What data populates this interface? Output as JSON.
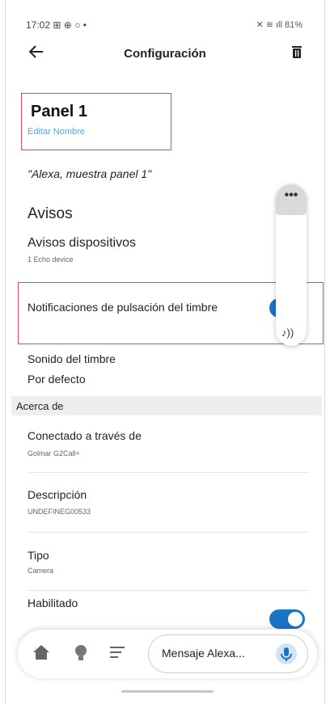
{
  "status_bar": {
    "time": "17:02",
    "icons": "⊞ ⊕ ○ •",
    "right": "✕ ≋ ıll 81%"
  },
  "header": {
    "title": "Configuración",
    "back_icon": "arrow-left-icon",
    "trash_icon": "trash-icon"
  },
  "device": {
    "name": "Panel 1",
    "edit_label": "Editar Nombre",
    "alexa_phrase": "\"Alexa, muestra panel 1\""
  },
  "avisos": {
    "heading": "Avisos",
    "dispositivos_title": "Avisos dispositivos",
    "dispositivos_sub": "1 Echo device",
    "notif_label": "Notificaciones de pulsación del timbre",
    "notif_enabled": true
  },
  "timbre": {
    "title": "Sonido del timbre",
    "value": "Por defecto"
  },
  "about": {
    "heading": "Acerca de",
    "items": [
      {
        "title": "Conectado a través de",
        "value": "Golmar G2Call+"
      },
      {
        "title": "Descripción",
        "value": "UNDEFINEG00533"
      },
      {
        "title": "Tipo",
        "value": "Camera"
      }
    ],
    "enabled_title": "Habilitado",
    "enabled": true
  },
  "floating": {
    "dots": "•••"
  },
  "bottom_nav": {
    "message_placeholder": "Mensaje Alexa...",
    "icons": [
      "home-icon",
      "bulb-icon",
      "list-icon",
      "mic-icon"
    ]
  },
  "colors": {
    "accent": "#1b73c4",
    "highlight": "#e0455a",
    "link": "#5aa7e0"
  }
}
